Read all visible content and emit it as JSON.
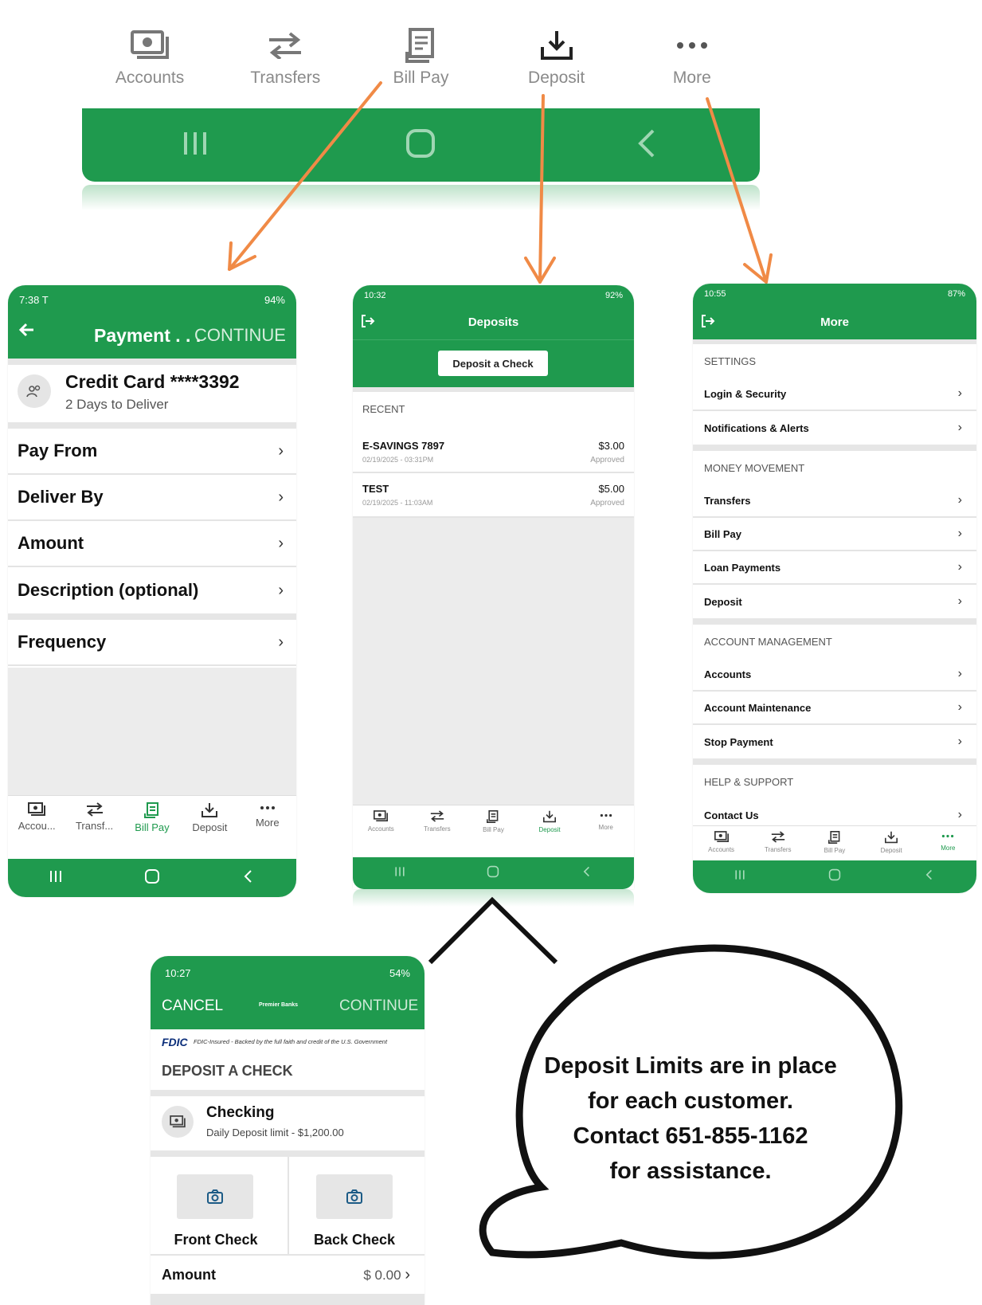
{
  "colors": {
    "brand_green": "#1f9a4e",
    "arrow_orange": "#f08a46",
    "grey_bg": "#ececec"
  },
  "top_nav": {
    "tabs": [
      {
        "label": "Accounts",
        "icon": "accounts-icon"
      },
      {
        "label": "Transfers",
        "icon": "transfers-icon"
      },
      {
        "label": "Bill Pay",
        "icon": "bill-pay-icon"
      },
      {
        "label": "Deposit",
        "icon": "deposit-icon"
      },
      {
        "label": "More",
        "icon": "more-icon"
      }
    ]
  },
  "payment_screen": {
    "status_time": "7:38",
    "status_carrier": "T",
    "status_right": "94%",
    "title": "Payment . . .",
    "continue": "CONTINUE",
    "payee_name": "Credit Card ****3392",
    "payee_sub": "2 Days to Deliver",
    "rows": [
      "Pay From",
      "Deliver By",
      "Amount",
      "Description (optional)"
    ],
    "frequency": "Frequency",
    "tabs": [
      "Accou...",
      "Transf...",
      "Bill Pay",
      "Deposit",
      "More"
    ]
  },
  "deposits_screen": {
    "status_time": "10:32",
    "status_right": "92%",
    "title": "Deposits",
    "deposit_button": "Deposit a Check",
    "recent_label": "RECENT",
    "items": [
      {
        "name": "E-SAVINGS 7897",
        "date": "02/19/2025 - 03:31PM",
        "amount": "$3.00",
        "status": "Approved"
      },
      {
        "name": "TEST",
        "date": "02/19/2025 - 11:03AM",
        "amount": "$5.00",
        "status": "Approved"
      }
    ],
    "tabs": [
      "Accounts",
      "Transfers",
      "Bill Pay",
      "Deposit",
      "More"
    ]
  },
  "more_screen": {
    "status_time": "10:55",
    "status_right": "87%",
    "title": "More",
    "sections": [
      {
        "header": "SETTINGS",
        "items": [
          "Login & Security",
          "Notifications & Alerts"
        ]
      },
      {
        "header": "MONEY MOVEMENT",
        "items": [
          "Transfers",
          "Bill Pay",
          "Loan Payments",
          "Deposit"
        ]
      },
      {
        "header": "ACCOUNT MANAGEMENT",
        "items": [
          "Accounts",
          "Account Maintenance",
          "Stop Payment"
        ]
      },
      {
        "header": "HELP & SUPPORT",
        "items": [
          "Contact Us"
        ]
      }
    ],
    "tabs": [
      "Accounts",
      "Transfers",
      "Bill Pay",
      "Deposit",
      "More"
    ]
  },
  "check_screen": {
    "status_time": "10:27",
    "status_right": "54%",
    "cancel": "CANCEL",
    "brand": "Premier Banks",
    "continue": "CONTINUE",
    "fdic_logo": "FDIC",
    "fdic_text": "FDIC-Insured - Backed by the full faith and credit of the U.S. Government",
    "section_title": "DEPOSIT A CHECK",
    "account_name": "Checking",
    "account_limit": "Daily Deposit limit - $1,200.00",
    "front_label": "Front Check",
    "back_label": "Back Check",
    "amount_label": "Amount",
    "amount_value": "$ 0.00"
  },
  "speech_bubble": {
    "lines": [
      "Deposit Limits are in place",
      "for each customer.",
      "Contact 651-855-1162",
      "for assistance."
    ]
  }
}
